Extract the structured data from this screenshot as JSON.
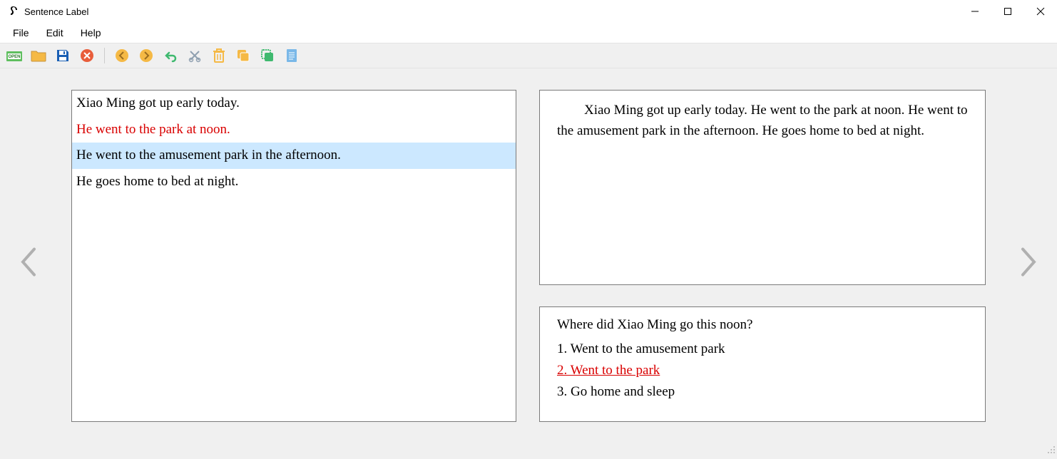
{
  "window": {
    "title": "Sentence Label"
  },
  "menu": {
    "file": "File",
    "edit": "Edit",
    "help": "Help"
  },
  "sentences": [
    {
      "text": "Xiao Ming got up early today.",
      "style": ""
    },
    {
      "text": "He went to the park at noon.",
      "style": "red"
    },
    {
      "text": "He went to the amusement park in the afternoon.",
      "style": "sel"
    },
    {
      "text": "He goes home to bed at night.",
      "style": ""
    }
  ],
  "paragraph": "Xiao Ming got up early today. He went to the park at noon. He went to the amusement park in the afternoon. He goes home to bed at night.",
  "qa": {
    "question": "Where did Xiao Ming go this noon?",
    "answers": [
      {
        "text": "1. Went to the amusement park",
        "correct": false
      },
      {
        "text": "2. Went to the park",
        "correct": true
      },
      {
        "text": "3. Go home and sleep",
        "correct": false
      }
    ]
  }
}
